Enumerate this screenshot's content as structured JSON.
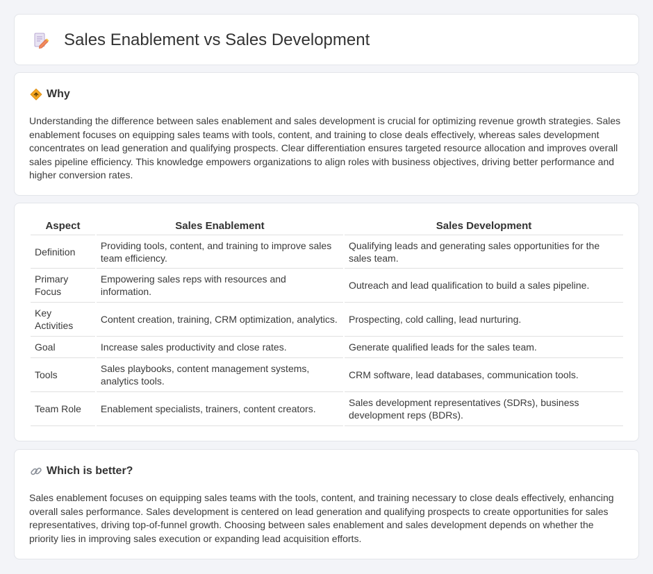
{
  "header": {
    "title": "Sales Enablement vs Sales Development",
    "icon": "document-pen-icon"
  },
  "why": {
    "icon": "diamond-sign-icon",
    "heading": "Why",
    "text": "Understanding the difference between sales enablement and sales development is crucial for optimizing revenue growth strategies. Sales enablement focuses on equipping sales teams with tools, content, and training to close deals effectively, whereas sales development concentrates on lead generation and qualifying prospects. Clear differentiation ensures targeted resource allocation and improves overall sales pipeline efficiency. This knowledge empowers organizations to align roles with business objectives, driving better performance and higher conversion rates."
  },
  "table": {
    "headers": [
      "Aspect",
      "Sales Enablement",
      "Sales Development"
    ],
    "rows": [
      [
        "Definition",
        "Providing tools, content, and training to improve sales team efficiency.",
        "Qualifying leads and generating sales opportunities for the sales team."
      ],
      [
        "Primary Focus",
        "Empowering sales reps with resources and information.",
        "Outreach and lead qualification to build a sales pipeline."
      ],
      [
        "Key Activities",
        "Content creation, training, CRM optimization, analytics.",
        "Prospecting, cold calling, lead nurturing."
      ],
      [
        "Goal",
        "Increase sales productivity and close rates.",
        "Generate qualified leads for the sales team."
      ],
      [
        "Tools",
        "Sales playbooks, content management systems, analytics tools.",
        "CRM software, lead databases, communication tools."
      ],
      [
        "Team Role",
        "Enablement specialists, trainers, content creators.",
        "Sales development representatives (SDRs), business development reps (BDRs)."
      ]
    ]
  },
  "better": {
    "icon": "link-icon",
    "heading": "Which is better?",
    "text": "Sales enablement focuses on equipping sales teams with the tools, content, and training necessary to close deals effectively, enhancing overall sales performance. Sales development is centered on lead generation and qualifying prospects to create opportunities for sales representatives, driving top-of-funnel growth. Choosing between sales enablement and sales development depends on whether the priority lies in improving sales execution or expanding lead acquisition efforts."
  }
}
